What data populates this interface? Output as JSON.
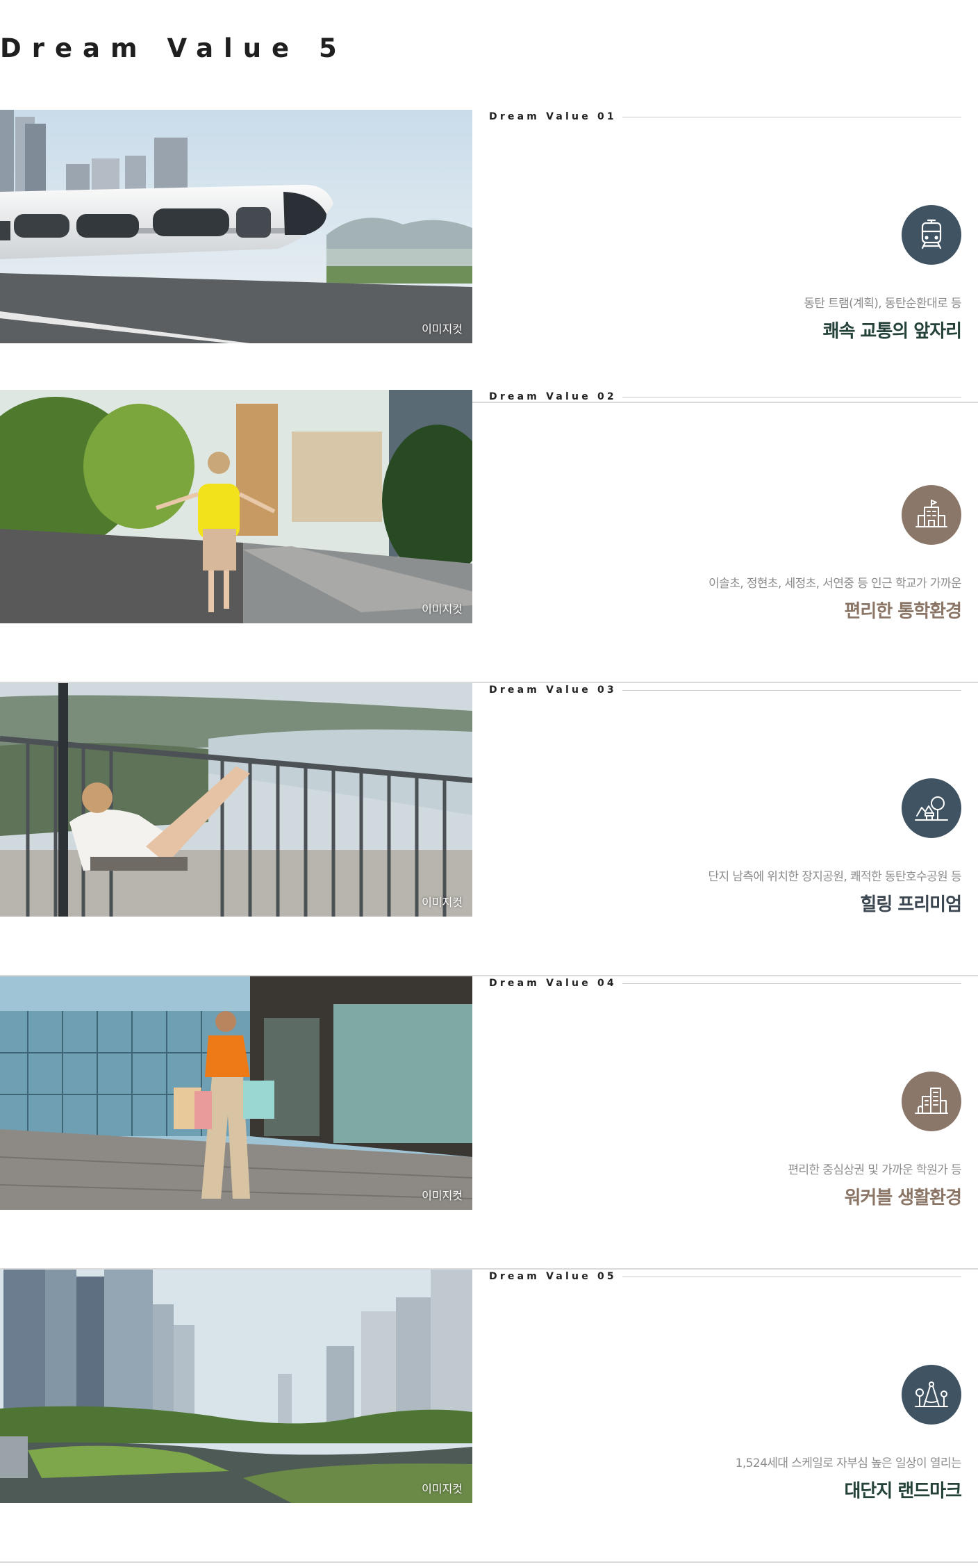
{
  "page": {
    "title": "Dream Value 5"
  },
  "colors": {
    "slate": "#3f5363",
    "taupe": "#8b7769",
    "ink_green": "#24423a",
    "taupe_text": "#8a7566",
    "slate_text": "#3b4650"
  },
  "sections": [
    {
      "eyebrow": "Dream Value 01",
      "caption": "이미지컷",
      "icon": "tram-icon",
      "desc": "동탄 트램(계획), 동탄순환대로 등",
      "headline": "쾌속 교통의 앞자리"
    },
    {
      "eyebrow": "Dream Value 02",
      "caption": "이미지컷",
      "icon": "school-icon",
      "desc": "이솔초, 정현초, 세정초, 서연중 등 인근 학교가 가까운",
      "headline": "편리한 통학환경"
    },
    {
      "eyebrow": "Dream Value 03",
      "caption": "이미지컷",
      "icon": "park-icon",
      "desc": "단지 남측에 위치한 장지공원, 쾌적한 동탄호수공원 등",
      "headline": "힐링 프리미엄"
    },
    {
      "eyebrow": "Dream Value 04",
      "caption": "이미지컷",
      "icon": "city-buildings-icon",
      "desc": "편리한 중심상권 및 가까운 학원가 등",
      "headline": "워커블 생활환경"
    },
    {
      "eyebrow": "Dream Value 05",
      "caption": "이미지컷",
      "icon": "landmark-compass-icon",
      "desc": "1,524세대 스케일로 자부심 높은 일상이 열리는",
      "headline": "대단지 랜드마크"
    }
  ]
}
